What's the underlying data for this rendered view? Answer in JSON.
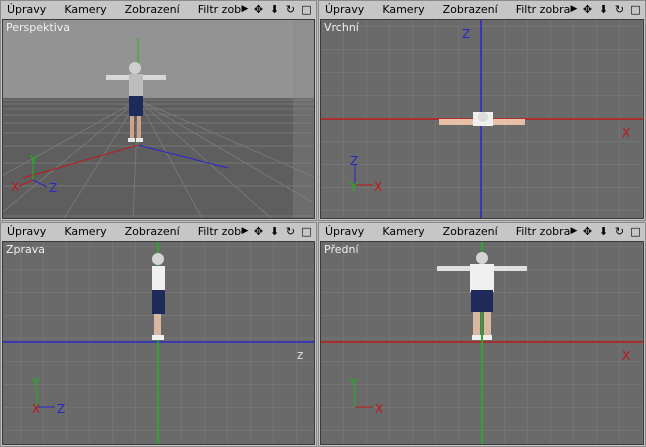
{
  "colors": {
    "x_axis": "#c01818",
    "y_axis": "#18b818",
    "z_axis": "#2828c8",
    "grid": "#7d7d7d",
    "background": "#6a6a6a"
  },
  "viewports": [
    {
      "label": "Perspektiva",
      "menu": [
        "Úpravy",
        "Kamery",
        "Zobrazení",
        "Filtr zobra"
      ],
      "axis_labels": {
        "x": "X",
        "y": "Y",
        "z": "Z"
      }
    },
    {
      "label": "Vrchní",
      "menu": [
        "Úpravy",
        "Kamery",
        "Zobrazení",
        "Filtr zobrazení"
      ],
      "axis_labels": {
        "x": "X",
        "y": "Y",
        "z": "Z",
        "main_x": "X",
        "main_z": "Z"
      }
    },
    {
      "label": "Zprava",
      "menu": [
        "Úpravy",
        "Kamery",
        "Zobrazení",
        "Filtr zobrazen"
      ],
      "axis_labels": {
        "x": "X",
        "y": "Y",
        "z": "Z",
        "main_z": "z"
      }
    },
    {
      "label": "Přední",
      "menu": [
        "Úpravy",
        "Kamery",
        "Zobrazení",
        "Filtr zobrazení"
      ],
      "axis_labels": {
        "x": "X",
        "y": "Y",
        "main_x": "X"
      }
    }
  ],
  "toolbar_icons": [
    "menu-arrow-icon",
    "move-icon",
    "dolly-icon",
    "rotate-icon",
    "maximize-icon"
  ],
  "toolbar_glyphs": {
    "arrow": "▶",
    "move": "✥",
    "dolly": "⬇",
    "rotate": "↻",
    "maximize": "□"
  }
}
